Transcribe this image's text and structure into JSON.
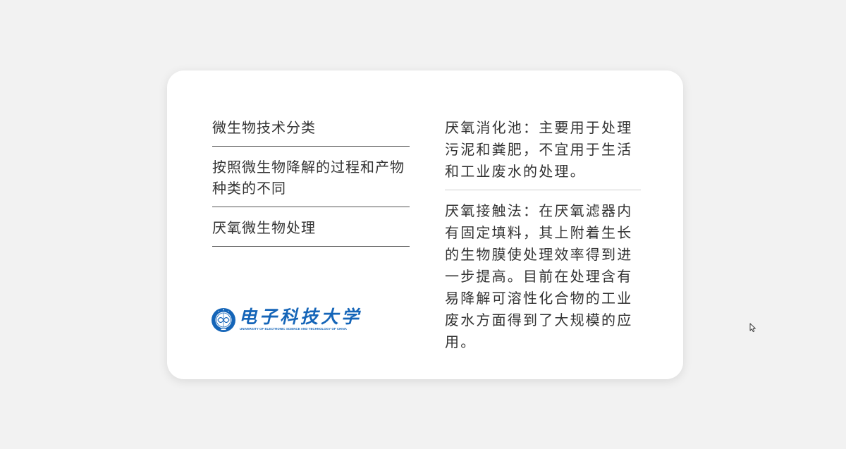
{
  "left_items": [
    "微生物技术分类",
    "按照微生物降解的过程和产物种类的不同",
    "厌氧微生物处理"
  ],
  "right_items": [
    "厌氧消化池：主要用于处理污泥和粪肥，不宜用于生活和工业废水的处理。",
    "厌氧接触法：在厌氧滤器内有固定填料，其上附着生长的生物膜使处理效率得到进一步提高。目前在处理含有易降解可溶性化合物的工业废水方面得到了大规模的应用。"
  ],
  "logo": {
    "name_cn": "电子科技大学",
    "name_en": "UNIVERSITY OF ELECTRONIC SCIENCE AND TECHNOLOGY OF CHINA",
    "brand_color": "#1565b8"
  },
  "icons": {
    "logo": "university-seal-icon",
    "cursor": "mouse-pointer-icon"
  }
}
